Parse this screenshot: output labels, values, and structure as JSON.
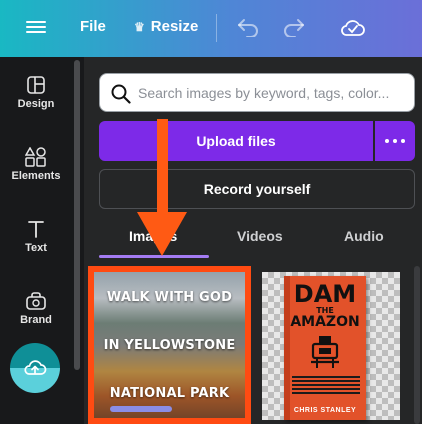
{
  "topbar": {
    "file_label": "File",
    "resize_label": "Resize"
  },
  "rail": {
    "items": [
      {
        "label": "Design"
      },
      {
        "label": "Elements"
      },
      {
        "label": "Text"
      },
      {
        "label": "Brand"
      }
    ]
  },
  "panel": {
    "search_placeholder": "Search images by keyword, tags, color...",
    "upload_label": "Upload files",
    "record_label": "Record yourself",
    "tabs": [
      {
        "label": "Images",
        "active": true
      },
      {
        "label": "Videos"
      },
      {
        "label": "Audio"
      }
    ],
    "thumbnails": [
      {
        "lines": [
          "WALK WITH GOD",
          "IN YELLOWSTONE",
          "NATIONAL PARK"
        ]
      },
      {
        "title_1": "DAM",
        "title_small": "THE",
        "title_2": "AMAZON",
        "author": "CHRIS STANLEY"
      }
    ]
  },
  "colors": {
    "accent_purple": "#7d2ae8",
    "annotation_orange": "#ff5a14"
  }
}
